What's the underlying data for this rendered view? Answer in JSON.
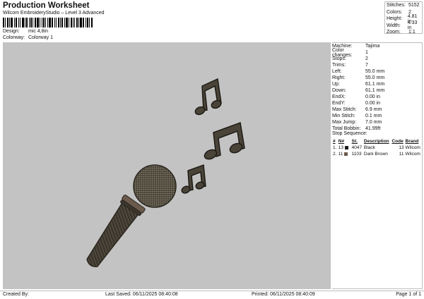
{
  "header": {
    "title": "Production Worksheet",
    "subtitle": "Wilcom EmbroideryStudio – Level 3 Advanced",
    "design_label": "Design:",
    "design_value": "mic 4,8in",
    "colorway_label": "Colorway:",
    "colorway_value": "Colorway 1"
  },
  "stats": [
    {
      "label": "Stitches:",
      "value": "5152"
    },
    {
      "label": "Colors:",
      "value": "2"
    },
    {
      "label": "Height:",
      "value": "4.81 in"
    },
    {
      "label": "Width:",
      "value": "4.33 in"
    },
    {
      "label": "Zoom:",
      "value": "1:1"
    }
  ],
  "info": [
    {
      "label": "Machine:",
      "value": "Tajima"
    },
    {
      "label": "Color changes:",
      "value": "1"
    },
    {
      "label": "Stops:",
      "value": "2"
    },
    {
      "label": "Trims:",
      "value": "7"
    },
    {
      "label": "Left:",
      "value": "55.0 mm"
    },
    {
      "label": "Right:",
      "value": "55.0 mm"
    },
    {
      "label": "Up:",
      "value": "61.1 mm"
    },
    {
      "label": "Down:",
      "value": "61.1 mm"
    },
    {
      "label": "EndX:",
      "value": "0.00 in"
    },
    {
      "label": "EndY:",
      "value": "0.00 in"
    },
    {
      "label": "Max Stitch:",
      "value": "6.9 mm"
    },
    {
      "label": "Min Stitch:",
      "value": "0.1 mm"
    },
    {
      "label": "Max Jump:",
      "value": "7.0 mm"
    },
    {
      "label": "Total Bobbin:",
      "value": "41.99ft"
    }
  ],
  "stop_sequence": {
    "title": "Stop Sequence:",
    "headers": {
      "num": "#",
      "n": "N#",
      "st": "St.",
      "desc": "Description",
      "code": "Code",
      "brand": "Brand"
    },
    "rows": [
      {
        "num": "1.",
        "n": "13",
        "color": "#1a1a1a",
        "st": "4047",
        "desc": "Black",
        "code": "13",
        "brand": "Wilcom"
      },
      {
        "num": "2.",
        "n": "11",
        "color": "#6b5a4c",
        "st": "1103",
        "desc": "Dark Brown",
        "code": "11",
        "brand": "Wilcom"
      }
    ]
  },
  "footer": {
    "created": "Created By:",
    "saved": "Last Saved: 06/11/2025 08:40:08",
    "printed": "Printed: 06/11/2025 08:40:09",
    "page": "Page 1 of 1"
  },
  "colors": {
    "canvas": "#c3c3c3",
    "thread_black": "#1a1a1a",
    "thread_brown": "#6b5a4c"
  }
}
